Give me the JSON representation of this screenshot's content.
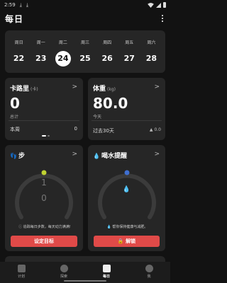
{
  "status_bar": {
    "time": "2:59"
  },
  "app": {
    "title": "每日"
  },
  "week": {
    "days": [
      "周日",
      "周一",
      "周二",
      "周三",
      "周四",
      "周五",
      "周六"
    ],
    "dates": [
      "22",
      "23",
      "24",
      "25",
      "26",
      "27",
      "28"
    ],
    "selected_index": 2
  },
  "calories": {
    "title": "卡路里",
    "unit": "(卡)",
    "value": "0",
    "sublabel": "总计",
    "week_label": "本周",
    "week_value": "0"
  },
  "weight": {
    "title": "体重",
    "unit": "(kg)",
    "value": "80.0",
    "sublabel": "今天",
    "range_label": "过去30天",
    "change": "▲ 0.0"
  },
  "steps": {
    "title": "步",
    "top_value": "1",
    "bottom_value": "0",
    "hint": "追踪每日步数，每天动力满满!",
    "button": "设定目标",
    "accent": "#c0d232"
  },
  "water": {
    "title": "喝水提醒",
    "hint": "帮你保持健康与减肥。",
    "button": "解锁",
    "accent": "#3f6fd1"
  },
  "tabs": [
    {
      "label": "计划",
      "icon": "plan-icon",
      "active": false
    },
    {
      "label": "探索",
      "icon": "compass-icon",
      "active": false
    },
    {
      "label": "每日",
      "icon": "calendar-icon",
      "active": true
    },
    {
      "label": "我",
      "icon": "profile-icon",
      "active": false
    }
  ],
  "colors": {
    "background": "#121212",
    "card": "#262626",
    "button": "#e04a48"
  }
}
